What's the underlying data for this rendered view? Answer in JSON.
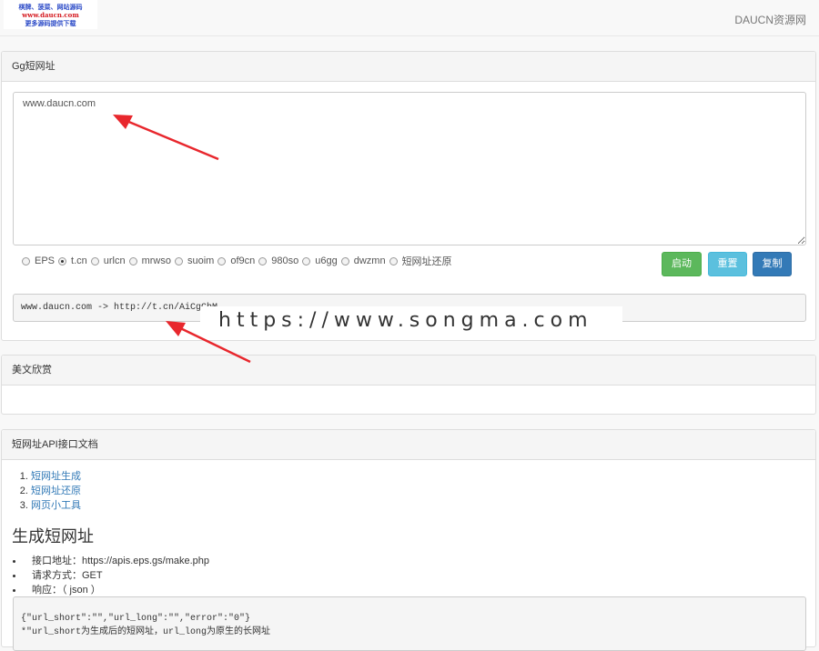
{
  "logo": {
    "line1": "棋牌、菠菜、网站源码",
    "line2": "www.daucn.com",
    "line3": "更多源码提供下载"
  },
  "navbar": {
    "brand": "DAUCN资源网"
  },
  "shortener": {
    "title": "Gg短网址",
    "input_value": "www.daucn.com",
    "services": [
      {
        "label": "EPS",
        "checked": false
      },
      {
        "label": "t.cn",
        "checked": true
      },
      {
        "label": "urlcn",
        "checked": false
      },
      {
        "label": "mrwso",
        "checked": false
      },
      {
        "label": "suoim",
        "checked": false
      },
      {
        "label": "of9cn",
        "checked": false
      },
      {
        "label": "980so",
        "checked": false
      },
      {
        "label": "u6gg",
        "checked": false
      },
      {
        "label": "dwzmn",
        "checked": false
      },
      {
        "label": "短网址还原",
        "checked": false
      }
    ],
    "buttons": {
      "start": "启动",
      "reset": "重置",
      "copy": "复制"
    },
    "result": "www.daucn.com -> http://t.cn/AiCgCbM",
    "watermark": "https://www.songma.com"
  },
  "articles": {
    "title": "美文欣赏"
  },
  "api_docs": {
    "title": "短网址API接口文档",
    "toc": [
      "短网址生成",
      "短网址还原",
      "网页小工具"
    ],
    "section_title": "生成短网址",
    "info": [
      "接口地址：https://apis.eps.gs/make.php",
      "请求方式：GET",
      "响应：（ json ）"
    ],
    "code_line1": "{\"url_short\":\"\",\"url_long\":\"\",\"error\":\"0\"}",
    "code_line2": "*\"url_short为生成后的短网址，url_long为原生的长网址"
  },
  "colors": {
    "success": "#5cb85c",
    "info": "#5bc0de",
    "primary": "#337ab7",
    "arrow": "#e8272d"
  }
}
